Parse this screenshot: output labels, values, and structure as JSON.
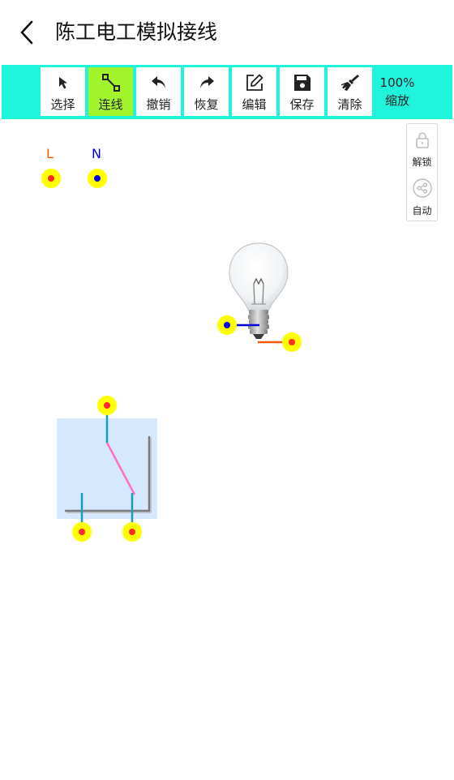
{
  "header": {
    "title": "陈工电工模拟接线"
  },
  "toolbar": {
    "tools": [
      {
        "label": "选择",
        "icon": "cursor-arrow-icon",
        "active": false
      },
      {
        "label": "连线",
        "icon": "connect-line-icon",
        "active": true
      },
      {
        "label": "撤销",
        "icon": "undo-icon",
        "active": false
      },
      {
        "label": "恢复",
        "icon": "redo-icon",
        "active": false
      },
      {
        "label": "编辑",
        "icon": "edit-icon",
        "active": false
      },
      {
        "label": "保存",
        "icon": "save-icon",
        "active": false
      },
      {
        "label": "清除",
        "icon": "broom-icon",
        "active": false
      }
    ],
    "zoom_value": "100%",
    "zoom_label": "缩放"
  },
  "side_panel": {
    "unlock_label": "解锁",
    "auto_label": "自动"
  },
  "canvas": {
    "power": {
      "live_label": "L",
      "neutral_label": "N"
    }
  },
  "colors": {
    "toolbar_bg": "#1ff5dc",
    "active_tool": "#a3f52b",
    "live": "#ff5a00",
    "neutral": "#0000dd",
    "terminal_fill": "#ffff00",
    "terminal_dot": "#ff2a2a",
    "switch_wire": "#1a9bc2",
    "switch_blade": "#ff6ec7",
    "switch_bg": "#d6e8ff"
  }
}
